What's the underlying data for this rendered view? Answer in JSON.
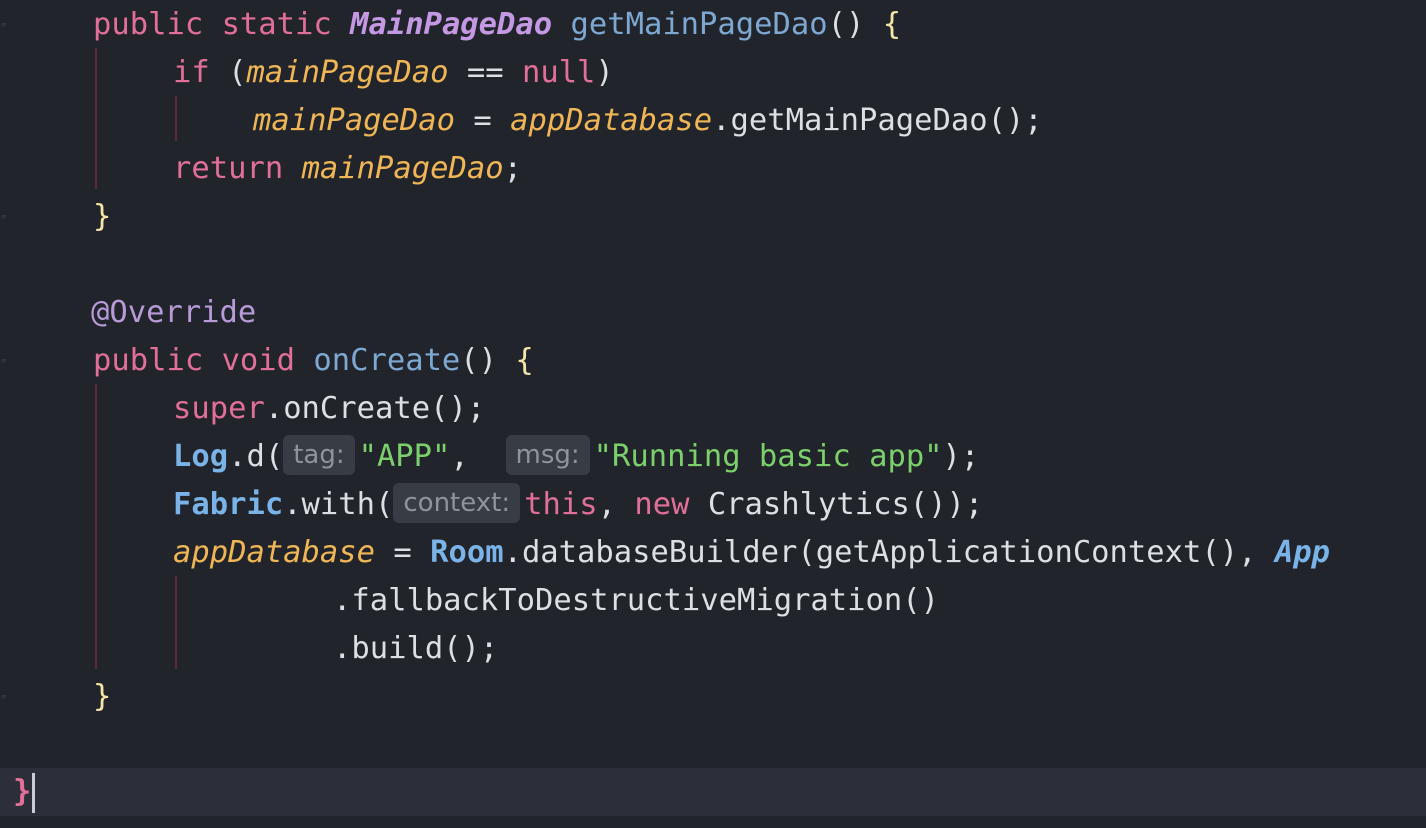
{
  "editor": {
    "theme_colors": {
      "background": "#21252b",
      "current_line": "#2c2f3a",
      "keyword": "#e16f9a",
      "type": "#c498e3",
      "method": "#7ea8d2",
      "field": "#f0b656",
      "string": "#7bd06b",
      "brace": "#f3e7a8",
      "indent_guide": "#5c2a3d"
    },
    "code": {
      "l1": {
        "public": "public",
        "static": "static",
        "type": "MainPageDao",
        "method": "getMainPageDao",
        "parens": "()",
        "brace": "{"
      },
      "l2": {
        "if": "if",
        "open": "(",
        "field": "mainPageDao",
        "op": "==",
        "null": "null",
        "close": ")"
      },
      "l3": {
        "field": "mainPageDao",
        "eq": "=",
        "db": "appDatabase",
        "call": ".getMainPageDao();"
      },
      "l4": {
        "return": "return",
        "field": "mainPageDao",
        "semi": ";"
      },
      "l5": {
        "brace": "}"
      },
      "l7": {
        "annotation": "@Override"
      },
      "l8": {
        "public": "public",
        "void": "void",
        "method": "onCreate",
        "parens": "()",
        "brace": "{"
      },
      "l9": {
        "super": "super",
        "call": ".onCreate();"
      },
      "l10": {
        "class": "Log",
        "call": ".d(",
        "hint_tag": "tag:",
        "str_tag": "\"APP\"",
        "comma": ",",
        "hint_msg": "msg:",
        "str_msg": "\"Running basic app\"",
        "end": ");"
      },
      "l11": {
        "class": "Fabric",
        "call": ".with(",
        "hint_context": "context:",
        "this": "this",
        "comma": ",",
        "new": "new",
        "ctor": "Crashlytics());"
      },
      "l12": {
        "field": "appDatabase",
        "eq": "=",
        "class": "Room",
        "call": ".databaseBuilder(getApplicationContext(),",
        "trailing": "App"
      },
      "l13": {
        "call": ".fallbackToDestructiveMigration()"
      },
      "l14": {
        "call": ".build();"
      },
      "l15": {
        "brace": "}"
      },
      "l17": {
        "brace": "}"
      }
    }
  }
}
